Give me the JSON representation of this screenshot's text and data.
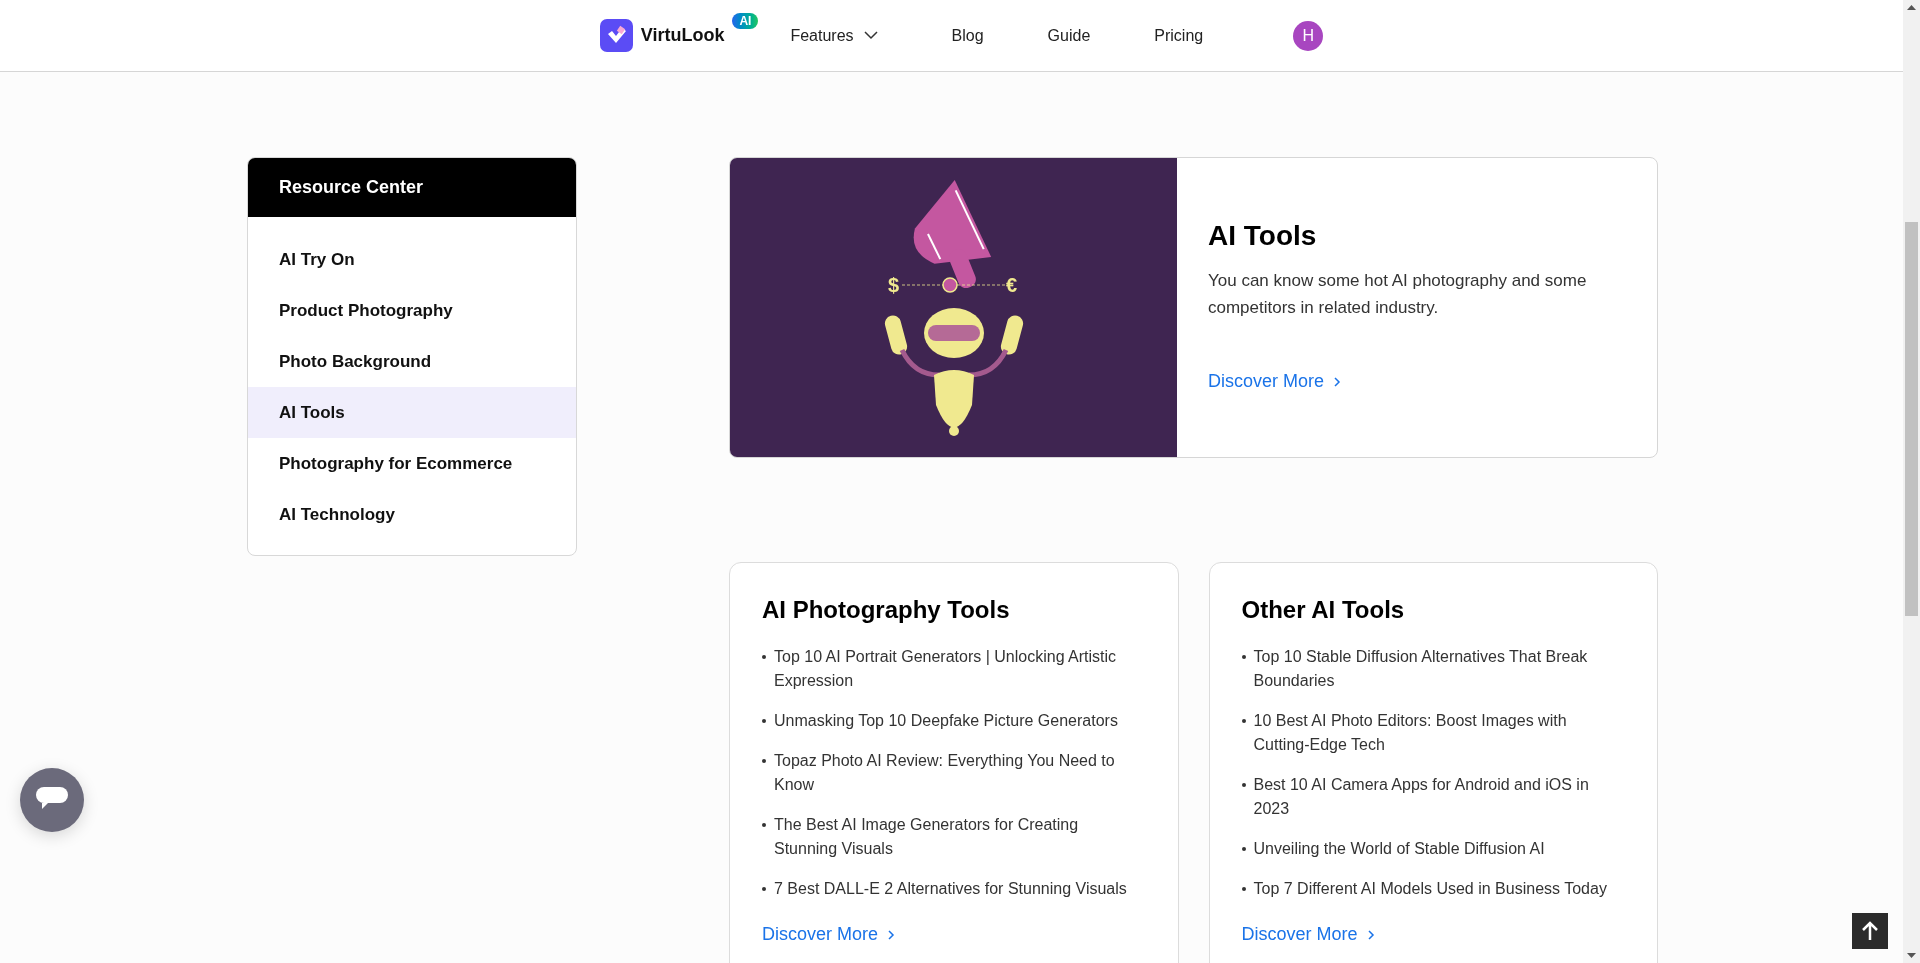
{
  "header": {
    "brand": "VirtuLook",
    "brand_badge": "AI",
    "nav": [
      {
        "label": "Features",
        "dropdown": true
      },
      {
        "label": "Blog",
        "dropdown": false
      },
      {
        "label": "Guide",
        "dropdown": false
      },
      {
        "label": "Pricing",
        "dropdown": false
      }
    ],
    "avatar": "H"
  },
  "sidebar": {
    "title": "Resource Center",
    "items": [
      {
        "label": "AI Try On",
        "selected": false
      },
      {
        "label": "Product Photography",
        "selected": false
      },
      {
        "label": "Photo Background",
        "selected": false
      },
      {
        "label": "AI Tools",
        "selected": true
      },
      {
        "label": "Photography for Ecommerce",
        "selected": false
      },
      {
        "label": "AI Technology",
        "selected": false
      }
    ]
  },
  "hero": {
    "illustration_symbols": [
      "$",
      "€"
    ],
    "title": "AI Tools",
    "description": "You can know some hot AI photography and some competitors in related industry.",
    "link": "Discover More"
  },
  "cards": [
    {
      "title": "AI Photography Tools",
      "items": [
        "Top 10 AI Portrait Generators | Unlocking Artistic Expression",
        "Unmasking Top 10 Deepfake Picture Generators",
        "Topaz Photo AI Review: Everything You Need to Know",
        "The Best AI Image Generators for Creating Stunning Visuals",
        "7 Best DALL-E 2 Alternatives for Stunning Visuals"
      ],
      "link": "Discover More"
    },
    {
      "title": "Other AI Tools",
      "items": [
        "Top 10 Stable Diffusion Alternatives That Break Boundaries",
        "10 Best AI Photo Editors: Boost Images with Cutting-Edge Tech",
        "Best 10 AI Camera Apps for Android and iOS in 2023",
        "Unveiling the World of Stable Diffusion AI",
        "Top 7 Different AI Models Used in Business Today"
      ],
      "link": "Discover More"
    }
  ]
}
